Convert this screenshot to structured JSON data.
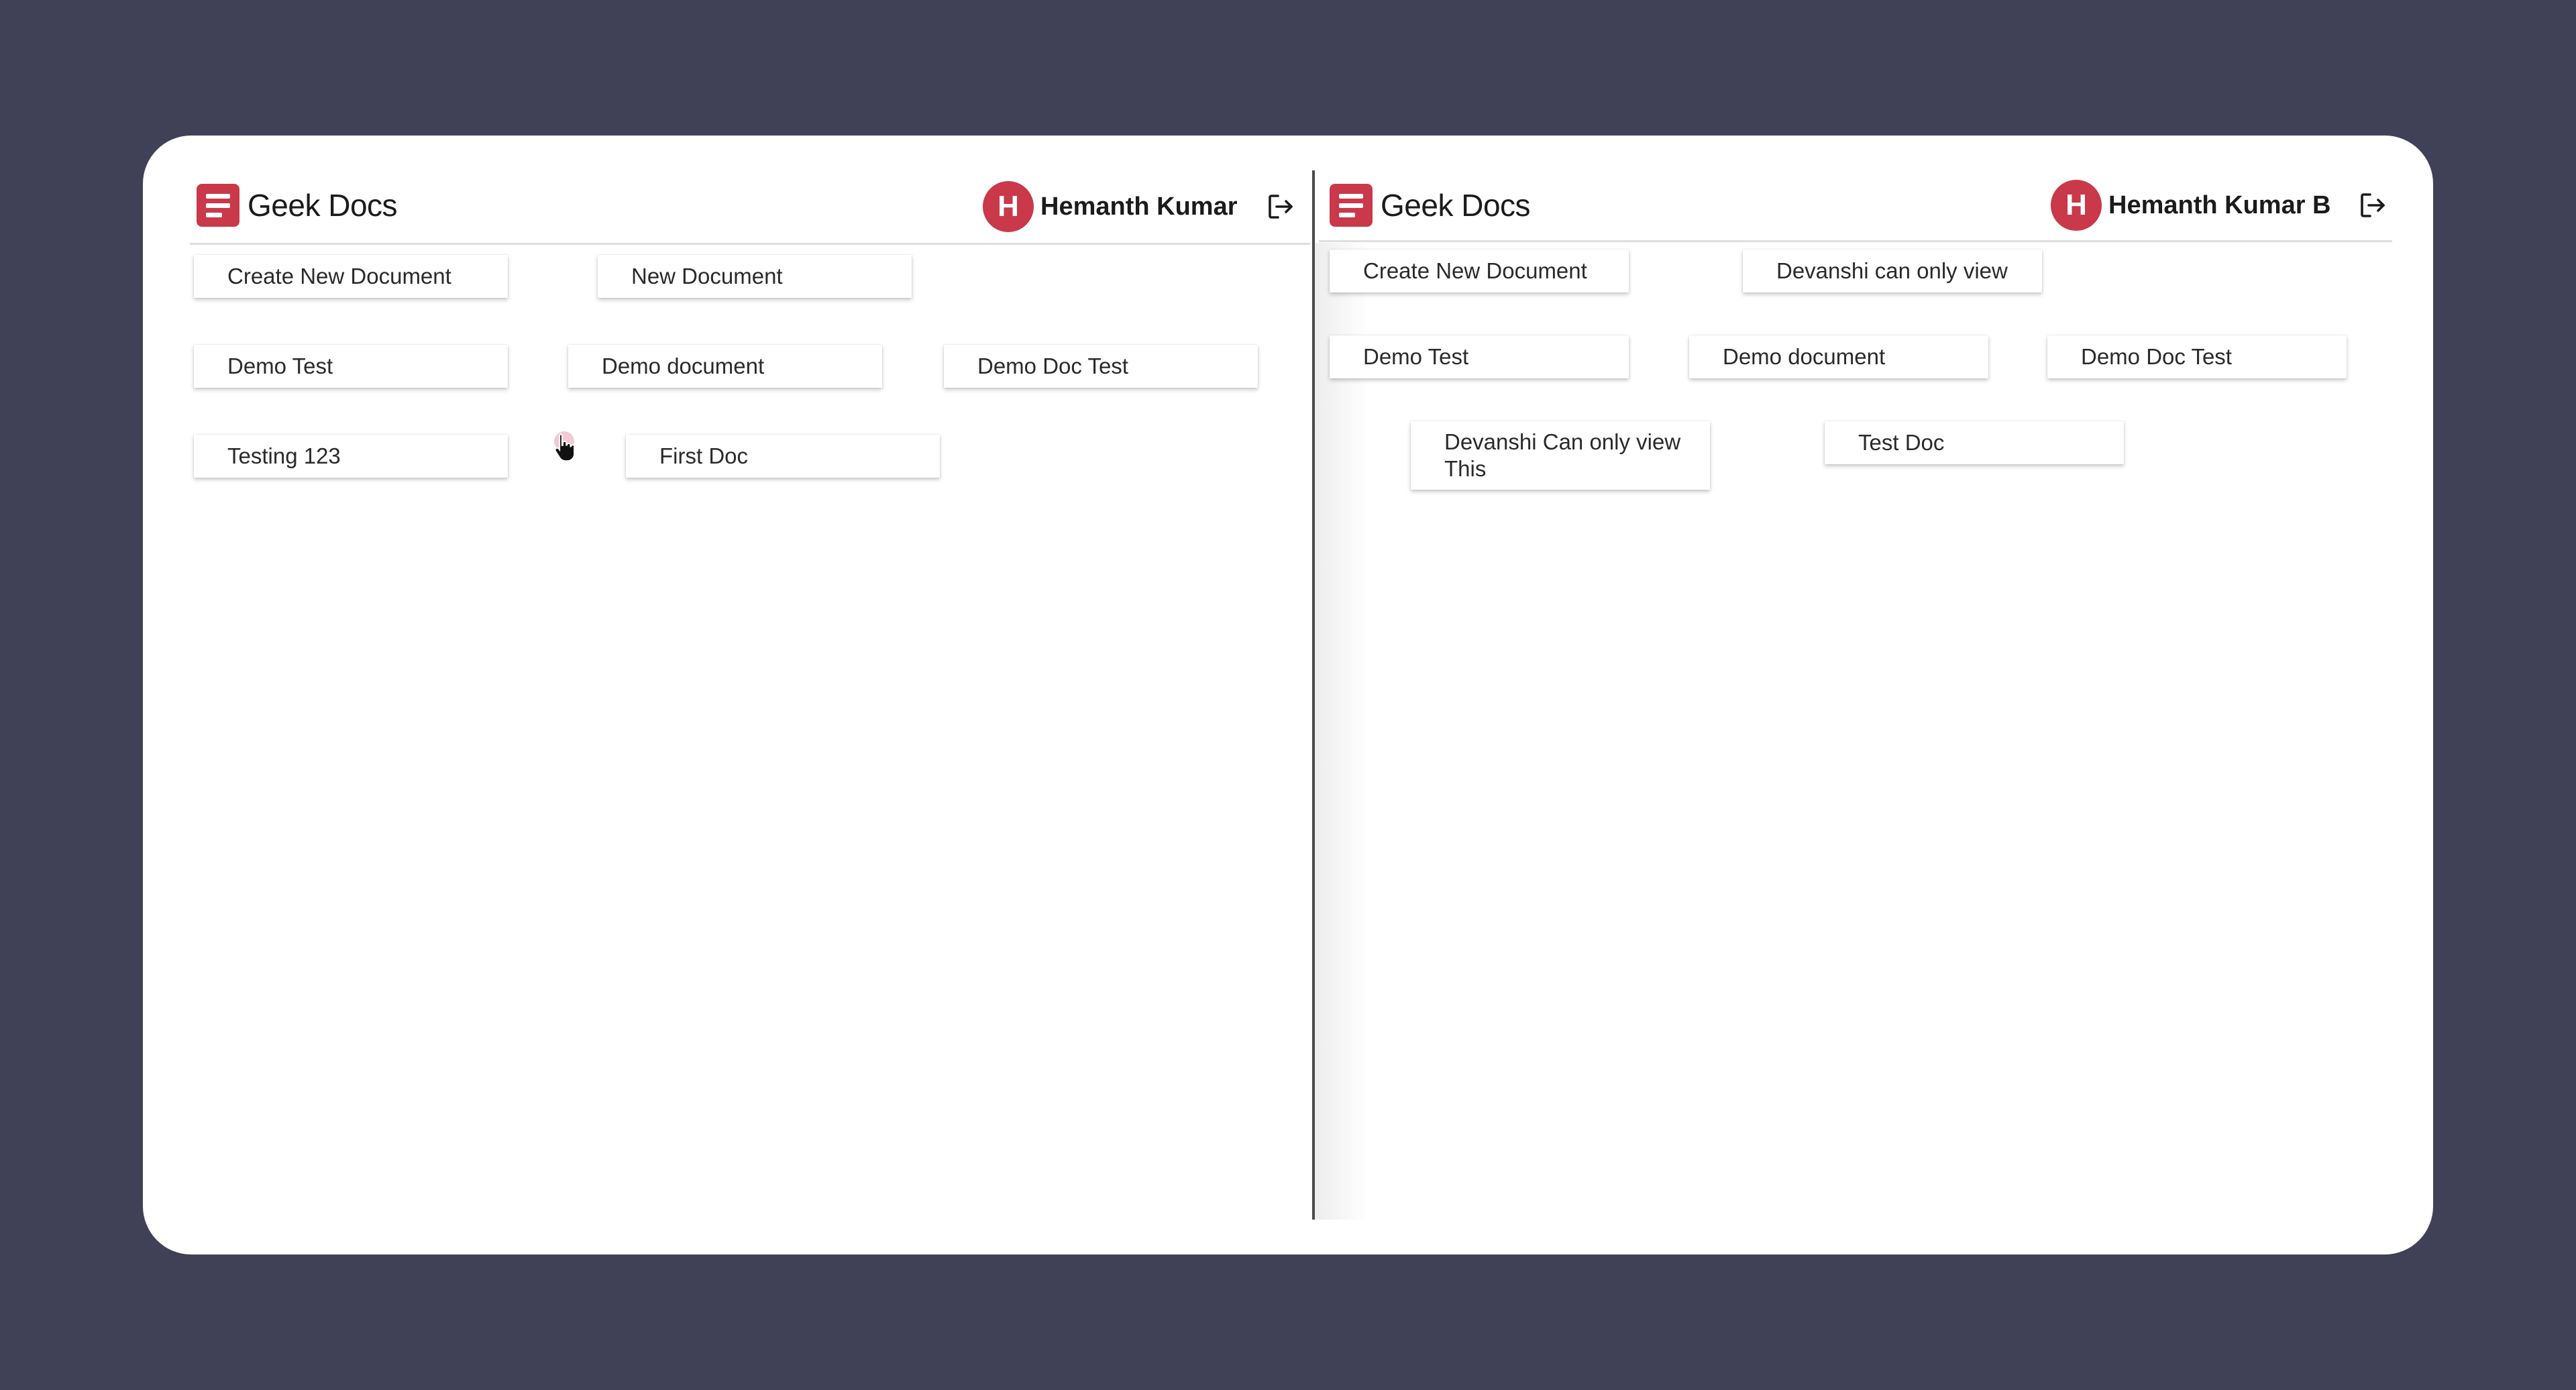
{
  "left": {
    "app_title": "Geek Docs",
    "user_initial": "H",
    "user_name": "Hemanth Kumar",
    "documents": [
      "Create New Document",
      "New Document",
      "Demo Test",
      "Demo document",
      "Demo Doc Test",
      "Testing 123",
      "First Doc"
    ]
  },
  "right": {
    "app_title": "Geek Docs",
    "user_initial": "H",
    "user_name": "Hemanth Kumar B",
    "documents": [
      "Create New Document",
      "Devanshi can only view",
      "Demo Test",
      "Demo document",
      "Demo Doc Test",
      "Devanshi Can only view This",
      "Test Doc"
    ]
  },
  "icons": {
    "logo": "document-lines-icon",
    "logout": "logout-icon",
    "cursor": "hand-pointer-icon"
  },
  "colors": {
    "background": "#404156",
    "accent": "#c9394a",
    "card": "#ffffff"
  }
}
